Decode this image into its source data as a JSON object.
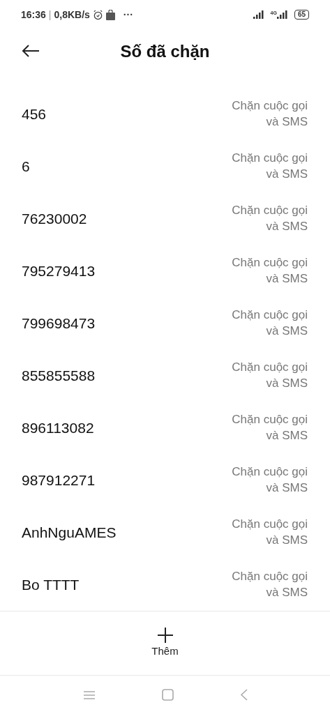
{
  "status_bar": {
    "time": "16:36",
    "separator": "|",
    "speed": "0,8KB/s",
    "more": "···",
    "battery": "65",
    "network": "4G"
  },
  "header": {
    "title": "Số đã chặn"
  },
  "rows": [
    {
      "number": "456",
      "status": "Chặn cuộc gọi và SMS"
    },
    {
      "number": "6",
      "status": "Chặn cuộc gọi và SMS"
    },
    {
      "number": "76230002",
      "status": "Chặn cuộc gọi và SMS"
    },
    {
      "number": "795279413",
      "status": "Chặn cuộc gọi và SMS"
    },
    {
      "number": "799698473",
      "status": "Chặn cuộc gọi và SMS"
    },
    {
      "number": "855855588",
      "status": "Chặn cuộc gọi và SMS"
    },
    {
      "number": "896113082",
      "status": "Chặn cuộc gọi và SMS"
    },
    {
      "number": "987912271",
      "status": "Chặn cuộc gọi và SMS"
    },
    {
      "number": "AnhNguAMES",
      "status": "Chặn cuộc gọi và SMS"
    },
    {
      "number": "Bo TTTT",
      "status": "Chặn cuộc gọi và SMS"
    }
  ],
  "add_button": {
    "label": "Thêm"
  }
}
